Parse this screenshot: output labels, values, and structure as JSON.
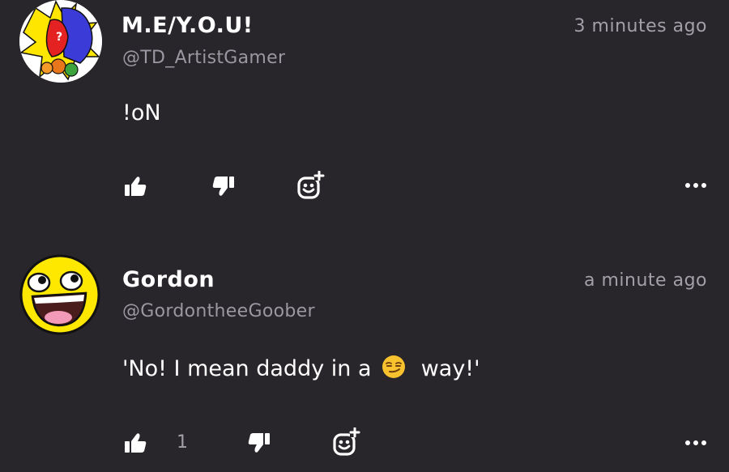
{
  "comments": [
    {
      "name": "M.E/Y.O.U!",
      "handle": "@TD_ArtistGamer",
      "time": "3 minutes ago",
      "text": "!oN",
      "likes": ""
    },
    {
      "name": "Gordon",
      "handle": "@GordontheeGoober",
      "time": "a minute ago",
      "text_before": "'No! I mean daddy in a",
      "text_after": "way!'",
      "emoji": "smirk-emoji",
      "likes": "1"
    }
  ],
  "icons": {
    "like": "thumbs-up-icon",
    "dislike": "thumbs-down-icon",
    "react": "add-reaction-icon",
    "more": "more-options-icon"
  }
}
